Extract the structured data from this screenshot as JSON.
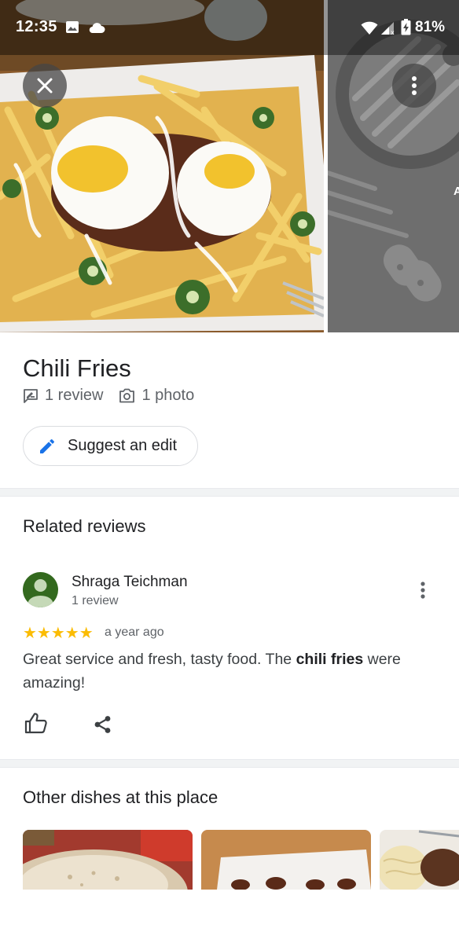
{
  "status_bar": {
    "time": "12:35",
    "battery": "81%"
  },
  "dish": {
    "title": "Chili Fries",
    "reviews": "1 review",
    "photos": "1 photo"
  },
  "actions": {
    "suggest_edit": "Suggest an edit"
  },
  "related_reviews": {
    "heading": "Related reviews",
    "review": {
      "author": "Shraga Teichman",
      "author_reviews": "1 review",
      "rating": 5,
      "stars": "★★★★★",
      "time": "a year ago",
      "text_before": "Great service and fresh, tasty food. The ",
      "text_highlight": "chili fries",
      "text_after": " were amazing!"
    }
  },
  "other_dishes": {
    "heading": "Other dishes at this place"
  },
  "colors": {
    "accent_blue": "#1a73e8",
    "star_yellow": "#fbbc04",
    "avatar_green": "#33691e"
  },
  "icons": [
    "close-icon",
    "more-vert-icon",
    "wifi-icon",
    "signal-icon",
    "battery-icon",
    "image-icon",
    "cloud-icon",
    "review-icon",
    "camera-icon",
    "pencil-icon",
    "thumb-up-icon",
    "share-icon"
  ]
}
